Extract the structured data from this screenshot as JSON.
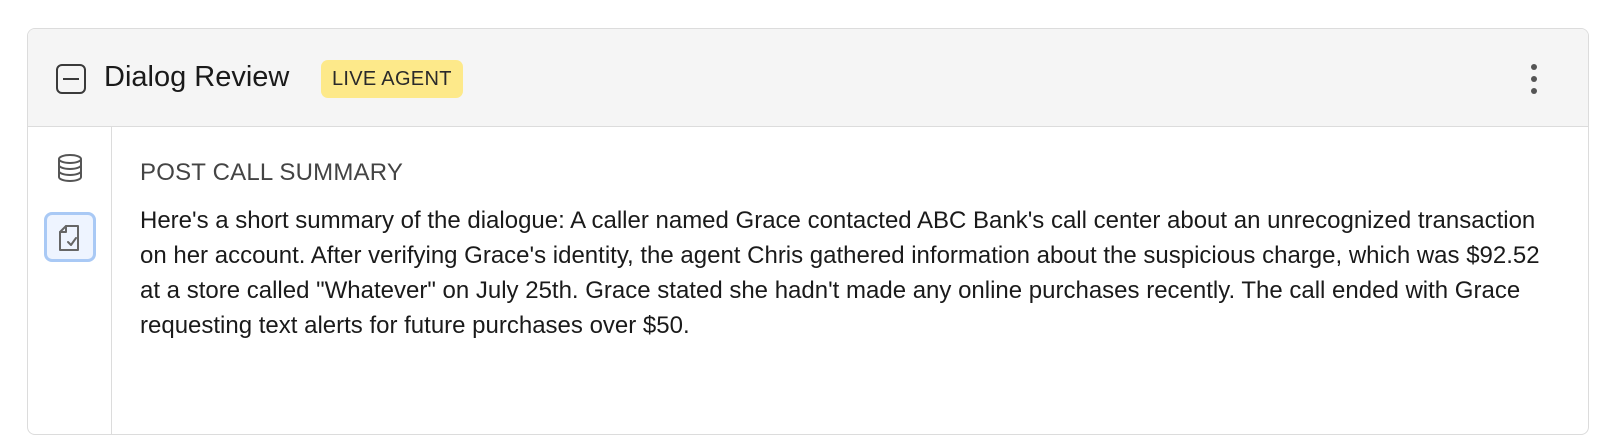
{
  "header": {
    "title": "Dialog Review",
    "badge": "LIVE AGENT",
    "collapse_icon": "collapse-icon",
    "more_icon": "more-vertical-icon"
  },
  "sidebar": {
    "icons": [
      "database-icon",
      "summary-clipboard-icon"
    ],
    "active": "summary-clipboard-icon"
  },
  "main": {
    "section_title": "POST CALL SUMMARY",
    "summary": "Here's a short summary of the dialogue: A caller named Grace contacted ABC Bank's call center about an unrecognized transaction on her account. After verifying Grace's identity, the agent Chris gathered information about the suspicious charge, which was $92.52 at a store called \"Whatever\" on July 25th. Grace stated she hadn't made any online purchases recently. The call ended with Grace requesting text alerts for future purchases over $50."
  },
  "colors": {
    "badge_bg": "#fde98a",
    "active_button_border": "#a9c9f5",
    "header_bg": "#f5f5f5"
  }
}
